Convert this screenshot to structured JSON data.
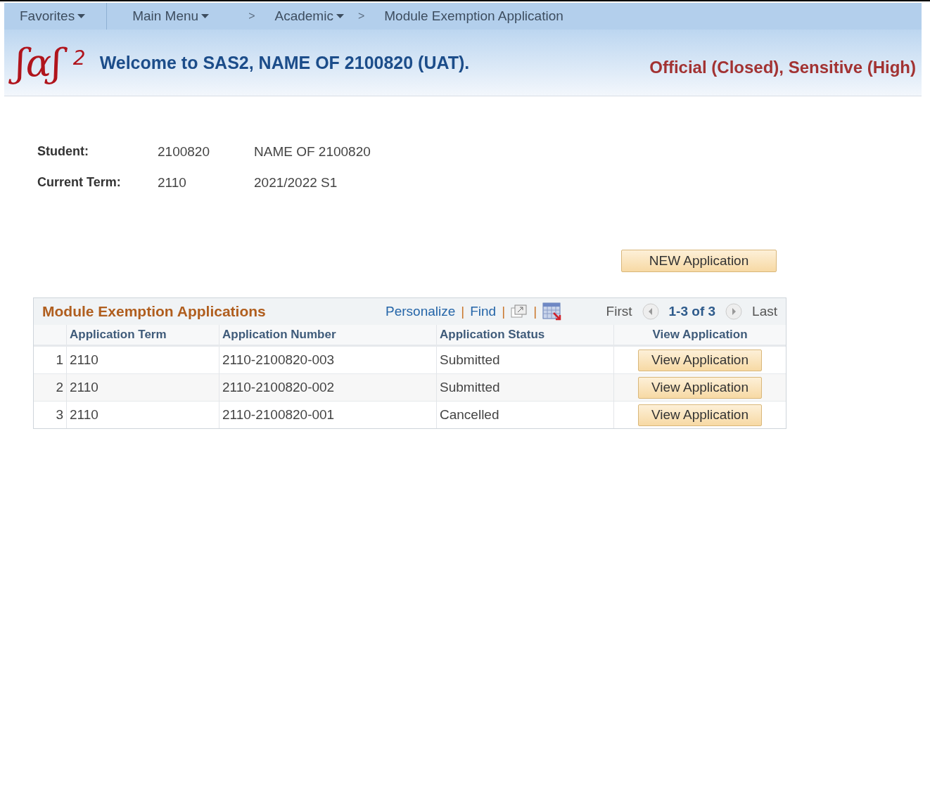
{
  "nav": [
    {
      "label": "Favorites",
      "kind": "menu"
    },
    {
      "label": "Main Menu",
      "kind": "menu"
    },
    {
      "label": ">",
      "kind": "sep"
    },
    {
      "label": "Academic",
      "kind": "menu"
    },
    {
      "label": ">",
      "kind": "sep"
    },
    {
      "label": "Module Exemption Application",
      "kind": "page"
    }
  ],
  "banner": {
    "logo": "ʃɑʃ",
    "logo_sup": "2",
    "welcome": "Welcome to SAS2, NAME OF 2100820 (UAT).",
    "classification": "Official (Closed), Sensitive (High)"
  },
  "student": [
    {
      "label": "Student:",
      "id": "2100820",
      "name": "NAME OF 2100820"
    },
    {
      "label": "Current Term:",
      "id": "2110",
      "name": "2021/2022 S1"
    }
  ],
  "new_button": "NEW Application",
  "grid": {
    "title": "Module Exemption Applications",
    "tools": [
      {
        "kind": "link",
        "label": "Personalize"
      },
      {
        "kind": "sep",
        "label": "|"
      },
      {
        "kind": "link",
        "label": "Find"
      },
      {
        "kind": "sep",
        "label": "|"
      },
      {
        "kind": "zoom"
      },
      {
        "kind": "sep",
        "label": "|"
      },
      {
        "kind": "download"
      }
    ],
    "pager": {
      "first": "First",
      "range": "1-3 of 3",
      "last": "Last"
    },
    "columns": [
      "Application Term",
      "Application Number",
      "Application Status",
      "View Application"
    ],
    "rows": [
      {
        "index": "1",
        "term": "2110",
        "number": "2110-2100820-003",
        "status": "Submitted",
        "action": "View Application"
      },
      {
        "index": "2",
        "term": "2110",
        "number": "2110-2100820-002",
        "status": "Submitted",
        "action": "View Application"
      },
      {
        "index": "3",
        "term": "2110",
        "number": "2110-2100820-001",
        "status": "Cancelled",
        "action": "View Application"
      }
    ]
  }
}
